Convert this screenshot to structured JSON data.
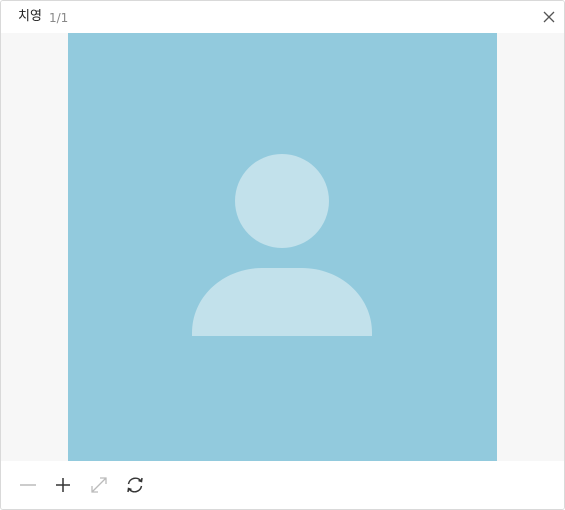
{
  "header": {
    "title": "치영",
    "counter": "1/1"
  },
  "image": {
    "kind": "default avatar placeholder",
    "background_color": "#92cadd",
    "figure_color": "#c2e1eb"
  },
  "toolbar": {
    "buttons": [
      {
        "name": "zoom-out",
        "icon": "minus-icon",
        "enabled": false
      },
      {
        "name": "zoom-in",
        "icon": "plus-icon",
        "enabled": true
      },
      {
        "name": "fit",
        "icon": "expand-icon",
        "enabled": false
      },
      {
        "name": "rotate",
        "icon": "rotate-icon",
        "enabled": true
      }
    ]
  },
  "colors": {
    "stage_background": "#f7f7f7",
    "icon_active": "#333333",
    "icon_disabled": "#bbbbbb"
  }
}
